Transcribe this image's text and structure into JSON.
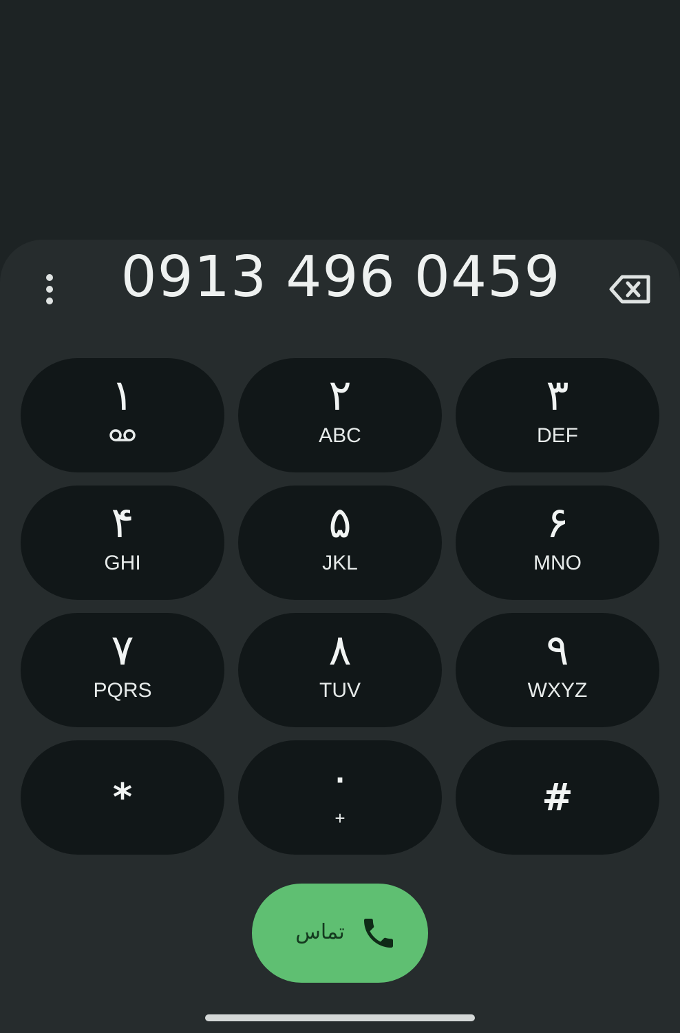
{
  "dialer": {
    "number": "0913 496 0459",
    "keys": [
      {
        "digit": "۱",
        "letters": "",
        "icon": "voicemail-icon"
      },
      {
        "digit": "۲",
        "letters": "ABC"
      },
      {
        "digit": "۳",
        "letters": "DEF"
      },
      {
        "digit": "۴",
        "letters": "GHI"
      },
      {
        "digit": "۵",
        "letters": "JKL"
      },
      {
        "digit": "۶",
        "letters": "MNO"
      },
      {
        "digit": "۷",
        "letters": "PQRS"
      },
      {
        "digit": "۸",
        "letters": "TUV"
      },
      {
        "digit": "۹",
        "letters": "WXYZ"
      },
      {
        "digit": "*",
        "letters": ""
      },
      {
        "digit": "۰",
        "letters": "+"
      },
      {
        "digit": "#",
        "letters": ""
      }
    ],
    "call_label": "تماس"
  },
  "icons": {
    "menu": "more-vertical-icon",
    "backspace": "backspace-icon",
    "call": "phone-icon"
  },
  "colors": {
    "background": "#1d2324",
    "sheet": "#262c2d",
    "key": "#111718",
    "call_button": "#5fbf72",
    "call_icon": "#0f2a17",
    "text": "#eef1f0"
  }
}
